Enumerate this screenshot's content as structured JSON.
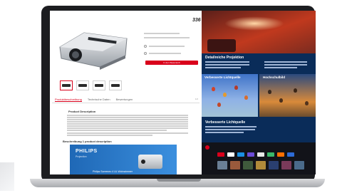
{
  "screen": {
    "left": {
      "brand_tag": "336",
      "section_heading": "Product Description",
      "section_heading_2": "Beschreibung 1 product description",
      "cta_label": "In den Warenkorb",
      "banner": {
        "logo": "PHILIPS",
        "sub": "Projection",
        "caption": "Philips Screeneo 4 UL Wohnzimmer"
      },
      "tabs": [
        {
          "label": "Produktbeschreibung",
          "active": true
        },
        {
          "label": "Technische Daten",
          "active": false
        },
        {
          "label": "Bewertungen",
          "active": false
        }
      ],
      "tab_badge": "1/2"
    },
    "right": {
      "hero_title": "Detailreiche Projektion",
      "img1_label": "Verbesserte Lichtquelle",
      "img2_label": "Hochschulbild",
      "sub_title": "Verbesserte Lichtquelle",
      "colors": {
        "panel_bg": "#0a2c59",
        "accent_red": "#d9001b"
      }
    }
  }
}
